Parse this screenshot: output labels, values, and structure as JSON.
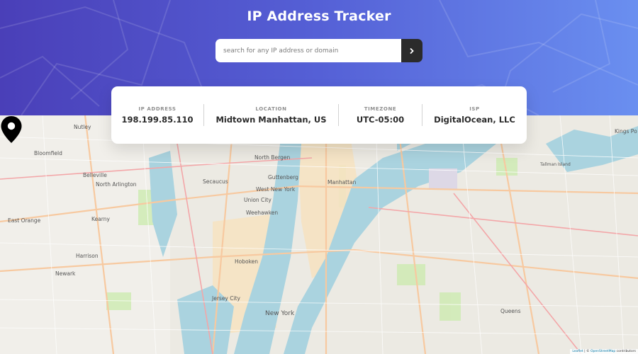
{
  "header": {
    "title": "IP Address Tracker",
    "search_placeholder": "search for any IP address or domain",
    "search_value": ""
  },
  "info": {
    "ip_label": "IP ADDRESS",
    "ip_value": "198.199.85.110",
    "location_label": "LOCATION",
    "location_value": "Midtown Manhattan, US",
    "timezone_label": "TIMEZONE",
    "timezone_value": "UTC-05:00",
    "isp_label": "ISP",
    "isp_value": "DigitalOcean, LLC"
  },
  "map": {
    "places": [
      "Nutley",
      "Bloomfield",
      "Belleville",
      "North Arlington",
      "Kearny",
      "East Orange",
      "Harrison",
      "Newark",
      "Secaucus",
      "North Bergen",
      "Guttenberg",
      "West New York",
      "Union City",
      "Weehawken",
      "Manhattan",
      "Hoboken",
      "Jersey City",
      "New York",
      "Kings Po",
      "Tallman Island",
      "Queens"
    ],
    "attribution_leaflet": "Leaflet",
    "attribution_sep": " | © ",
    "attribution_osm": "OpenStreetMap",
    "attribution_suffix": " contributors"
  },
  "colors": {
    "gradient_start": "#4a3fb8",
    "gradient_end": "#6a8ff0",
    "button_bg": "#2b2b2b",
    "water": "#aad3df",
    "land": "#eceae3"
  },
  "icons": {
    "search_button": "chevron-right-icon",
    "marker": "location-pin-icon"
  }
}
